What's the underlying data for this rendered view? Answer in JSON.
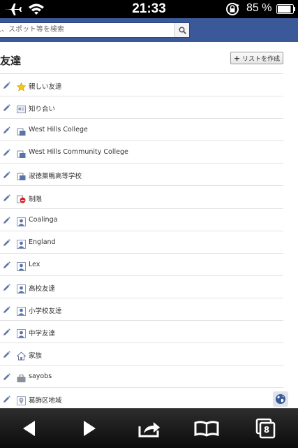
{
  "status_bar": {
    "time": "21:33",
    "battery_percent": "85 %",
    "icons": [
      "airplane-icon",
      "wifi-icon",
      "rotation-lock-icon",
      "battery-icon"
    ]
  },
  "search": {
    "placeholder": "人、スポット等を検索"
  },
  "header": {
    "title": "友達",
    "create_list_label": "リストを作成"
  },
  "lists": [
    {
      "label": "親しい友達",
      "icon": "star-icon"
    },
    {
      "label": "知り合い",
      "icon": "acquaintance-icon"
    },
    {
      "label": "West Hills College",
      "icon": "school-icon"
    },
    {
      "label": "West Hills Community College",
      "icon": "school-icon"
    },
    {
      "label": "淑徳巣鴨高等学校",
      "icon": "school-icon"
    },
    {
      "label": "制限",
      "icon": "restricted-icon"
    },
    {
      "label": "Coalinga",
      "icon": "person-icon"
    },
    {
      "label": "England",
      "icon": "person-icon"
    },
    {
      "label": "Lex",
      "icon": "person-icon"
    },
    {
      "label": "高校友達",
      "icon": "person-icon"
    },
    {
      "label": "小学校友達",
      "icon": "person-icon"
    },
    {
      "label": "中学友達",
      "icon": "person-icon"
    },
    {
      "label": "家族",
      "icon": "family-icon"
    },
    {
      "label": "sayobs",
      "icon": "work-icon"
    },
    {
      "label": "葛飾区地域",
      "icon": "location-icon"
    }
  ],
  "toolbar": {
    "tabs_count": "8",
    "icons": [
      "back-icon",
      "forward-icon",
      "share-icon",
      "bookmarks-icon",
      "tabs-icon"
    ]
  },
  "colors": {
    "facebook_blue": "#3b5998",
    "edit_pencil": "#5b74a8",
    "star": "#f5c518",
    "restricted": "#d22"
  }
}
